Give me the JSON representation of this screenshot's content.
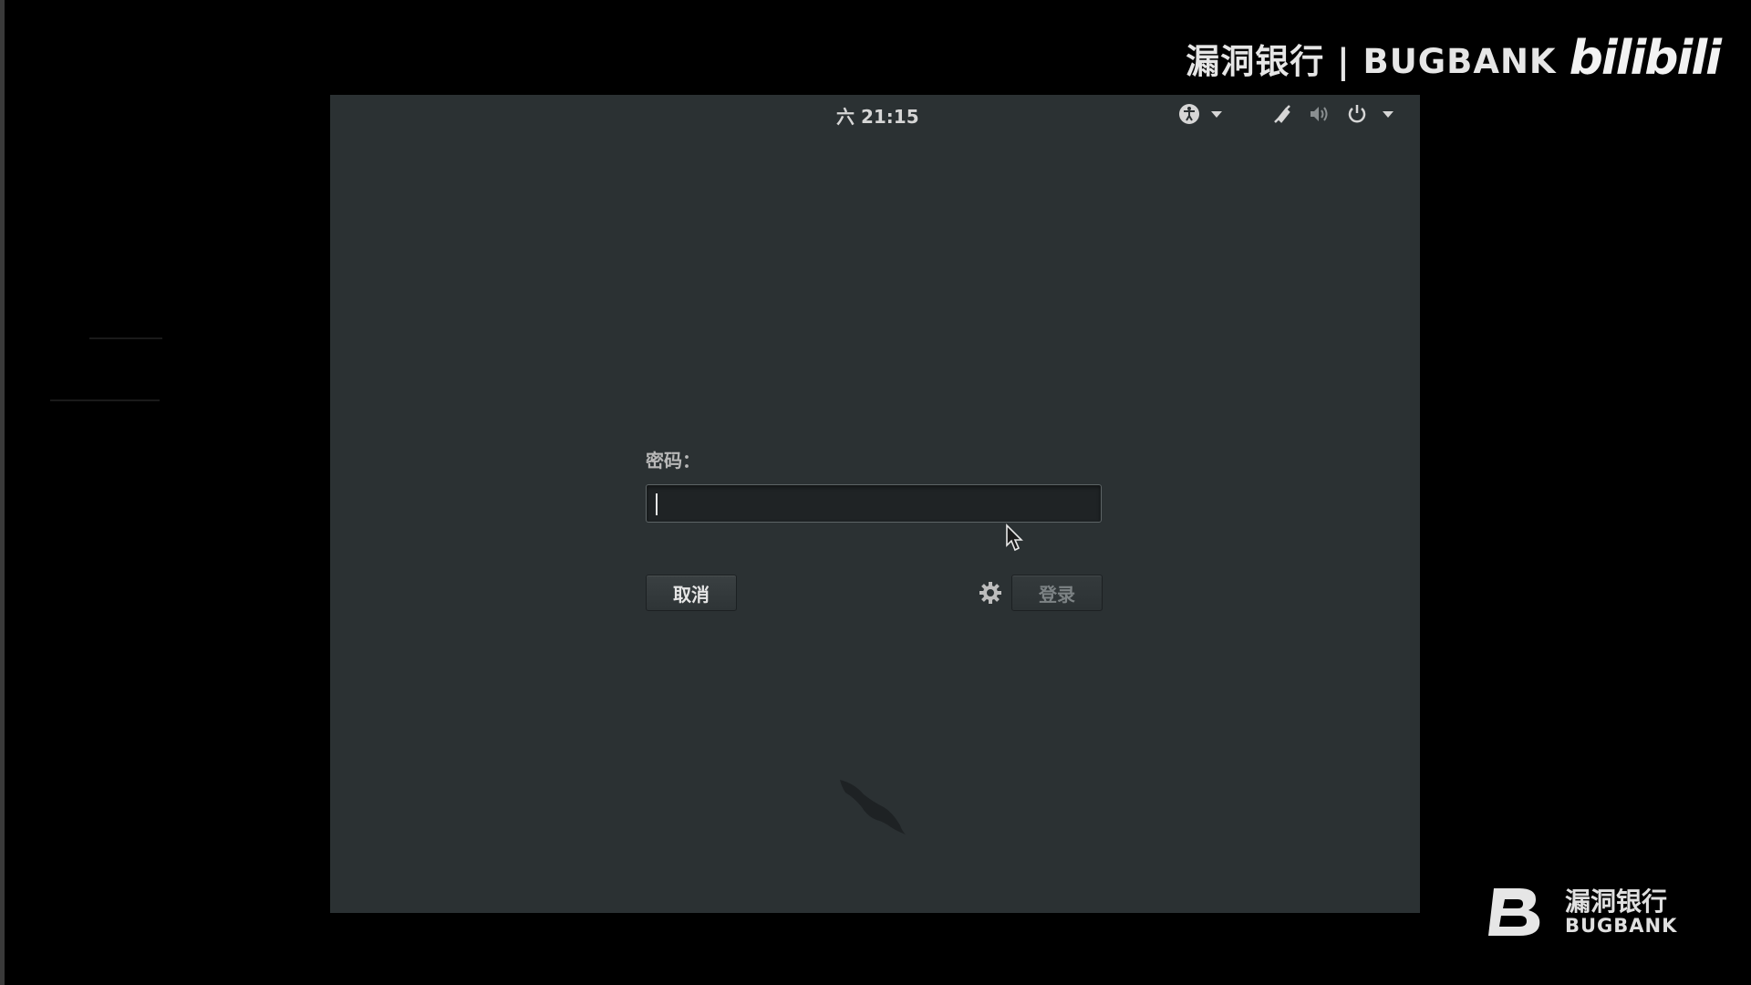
{
  "watermark_top": {
    "text": "漏洞银行 | BUGBANK",
    "brand": "bilibili"
  },
  "watermark_bottom": {
    "cn": "漏洞银行",
    "en": "BUGBANK"
  },
  "vm": {
    "topbar": {
      "clock": "六 21:15",
      "icons": [
        "accessibility-icon",
        "caret-down-icon",
        "network-icon",
        "volume-icon",
        "power-icon",
        "caret-down-icon"
      ]
    },
    "login": {
      "password_label": "密码：",
      "password_value": "",
      "cancel_label": "取消",
      "login_label": "登录"
    }
  },
  "colors": {
    "desktop_bg": "#2b3133",
    "outer_bg": "#000000",
    "text": "#d6d6d6",
    "disabled_text": "#7d8385"
  }
}
